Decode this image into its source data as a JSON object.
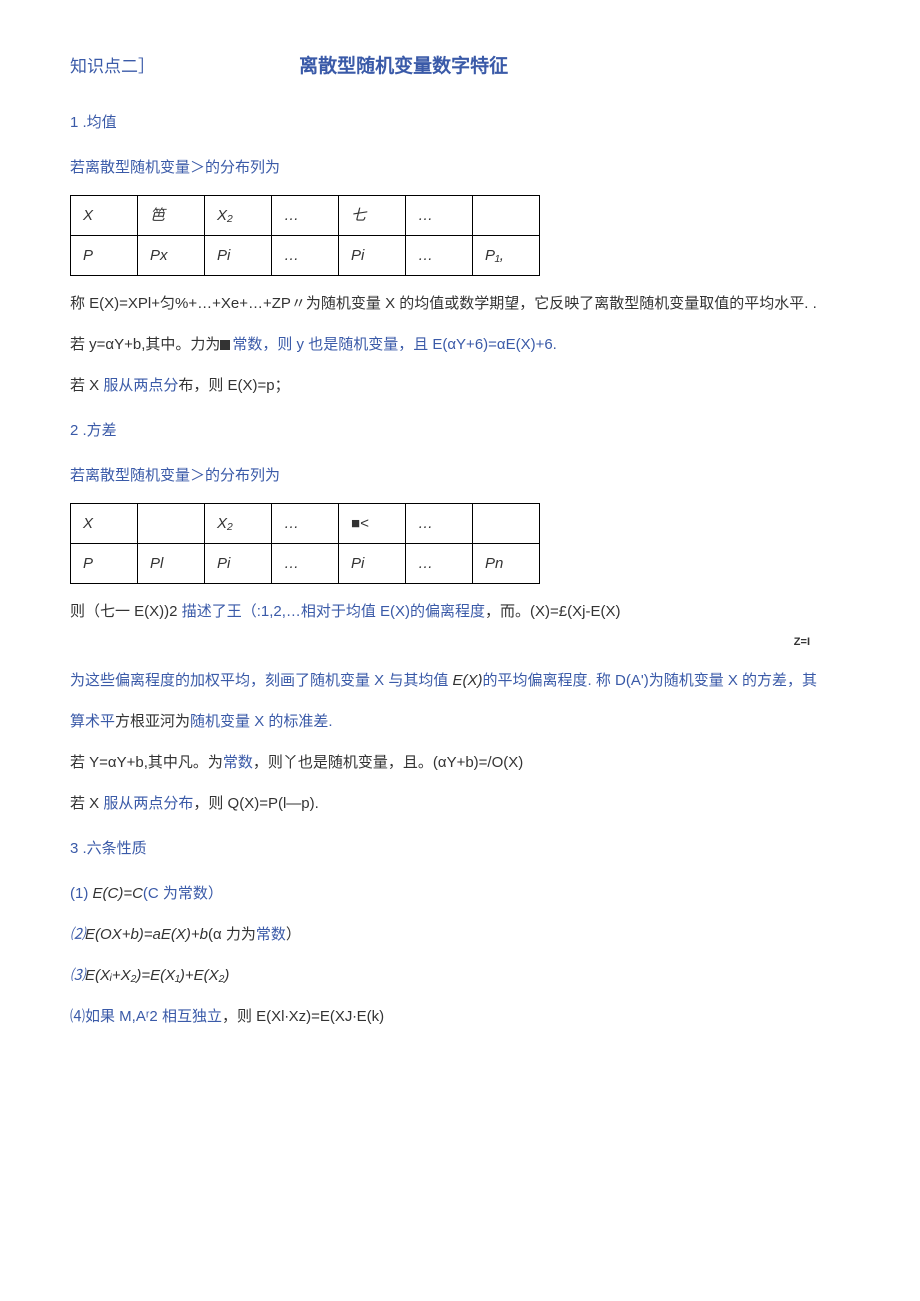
{
  "header": {
    "tag": "知识点二］",
    "title": "离散型随机变量数字特征"
  },
  "section1": {
    "num": "1 .均值",
    "intro": "若离散型随机变量＞的分布列为",
    "table": {
      "r1": [
        "X",
        "笆",
        "X₂",
        "…",
        "七",
        "…",
        ""
      ],
      "r2": [
        "P",
        "Px",
        "Pi",
        "…",
        "Pi",
        "…",
        "P₁,"
      ]
    },
    "para1": "称 E(X)=XPl+匀%+…+Xe+…+ZP〃为随机变量 X 的均值或数学期望，它反映了离散型随机变量取值的平均水平. .",
    "para2_a": "若 y=αY+b,其中。力为",
    "para2_b": "常数，则 y 也是随机变量，且 E(αY+6)=αE(X)+6.",
    "para3_a": "若 X ",
    "para3_b": "服从两点分",
    "para3_c": "布，则 E(X)=p；"
  },
  "section2": {
    "num": "2  .方差",
    "intro": "若离散型随机变量＞的分布列为",
    "table": {
      "r1": [
        "X",
        "",
        "X₂",
        "…",
        "■<",
        "…",
        ""
      ],
      "r2": [
        "P",
        "Pl",
        "Pi",
        "…",
        "Pi",
        "…",
        "Pn"
      ]
    },
    "line1_a": "则（七一 E(X))2 ",
    "line1_b": "描述了王（:1,2,…相对于均值 E(X)的偏离程度",
    "line1_c": "，而。(X)=£(Xj-E(X)",
    "zi": "Z=I",
    "para2_a": "为这些偏离程度的加权平均，刻画了随机变量 X 与其均值 ",
    "para2_b": "E(X)",
    "para2_c": "的平均偏离程度. 称 D(A')为随机变量 X 的方差，其",
    "para3_a": "算术平",
    "para3_b": "方根亚河为",
    "para3_c": "随机变量 X ",
    "para3_d": "的标准差.",
    "para4_a": "若 Y=αY+b,其中凡。为",
    "para4_b": "常数",
    "para4_c": "，则丫也是随机变量，且。(αY+b)=/O(X)",
    "para5_a": "若 X ",
    "para5_b": "服从两点分布",
    "para5_c": "，则 Q(X)=P(l—p)."
  },
  "section3": {
    "num": "3  .六条性质",
    "i1_a": "(1)   ",
    "i1_b": "E(C)=C",
    "i1_c": "(C 为常数）",
    "i2_a": "⑵",
    "i2_b": "E(OX+b)=aE(X)+b",
    "i2_c": "(α 力为",
    "i2_d": "常数",
    "i2_e": "）",
    "i3_a": "⑶",
    "i3_b": "E(Xᵢ+X₂)=E(X₁)+E(X₂)",
    "i4_a": "⑷如果 M,Aʳ2 ",
    "i4_b": "相互独立",
    "i4_c": "，则 E(Xl∙Xz)=E(XJ∙E(k)"
  }
}
